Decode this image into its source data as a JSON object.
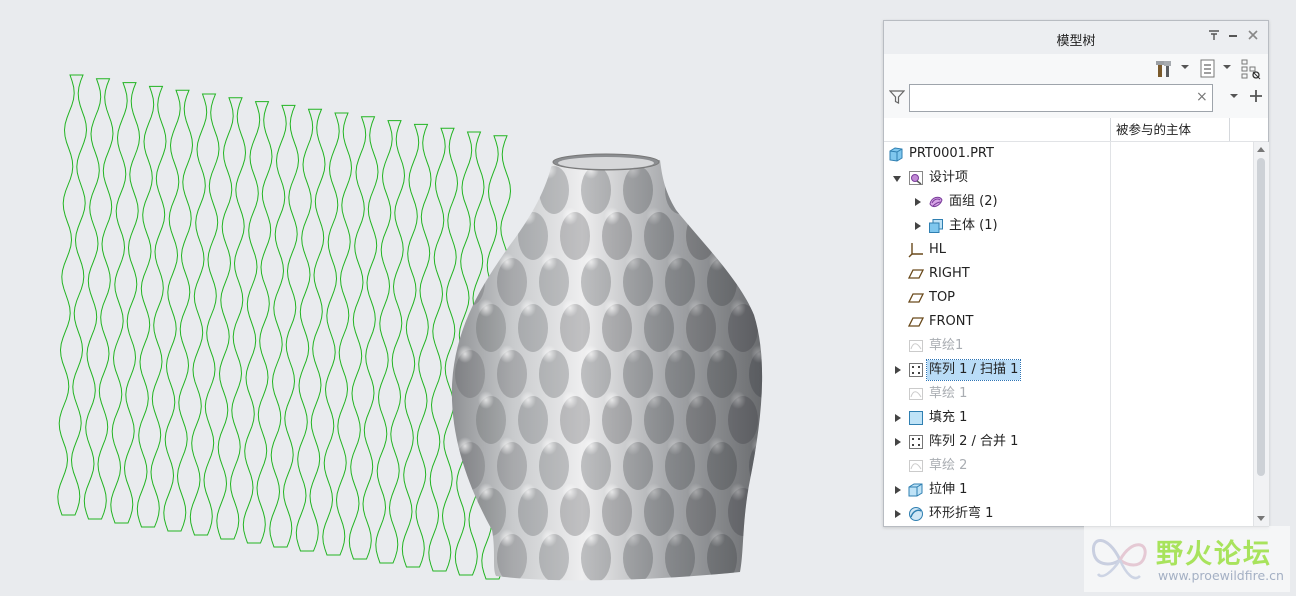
{
  "panel": {
    "title": "模型树",
    "search": {
      "value": "",
      "placeholder": ""
    },
    "column_header": "被参与的主体"
  },
  "tree": {
    "root": "PRT0001.PRT",
    "design_items": "设计项",
    "quilts": "面组 (2)",
    "bodies": "主体 (1)",
    "csys": "HL",
    "plane_right": "RIGHT",
    "plane_top": "TOP",
    "plane_front": "FRONT",
    "sketch1": "草绘1",
    "pattern1": "阵列 1 / 扫描 1",
    "sketch1b": "草绘 1",
    "fill1": "填充 1",
    "pattern2": "阵列 2 / 合并 1",
    "sketch2": "草绘 2",
    "extrude1": "拉伸 1",
    "toroidal_bend1": "环形折弯 1"
  },
  "watermark": {
    "name": "野火论坛",
    "url": "www.proewildfire.cn"
  },
  "colors": {
    "sketch_curves": "#22b422",
    "selection": "#b9dcf7",
    "watermark_green": "#a8e35c"
  },
  "icons": [
    "filter-icon",
    "tools-icon",
    "tree-settings-icon",
    "columns-icon",
    "add-icon",
    "part-icon",
    "design-items-icon",
    "quilt-icon",
    "body-icon",
    "csys-icon",
    "datum-plane-icon",
    "sketch-icon",
    "pattern-icon",
    "fill-icon",
    "extrude-icon",
    "toroidal-bend-icon"
  ]
}
